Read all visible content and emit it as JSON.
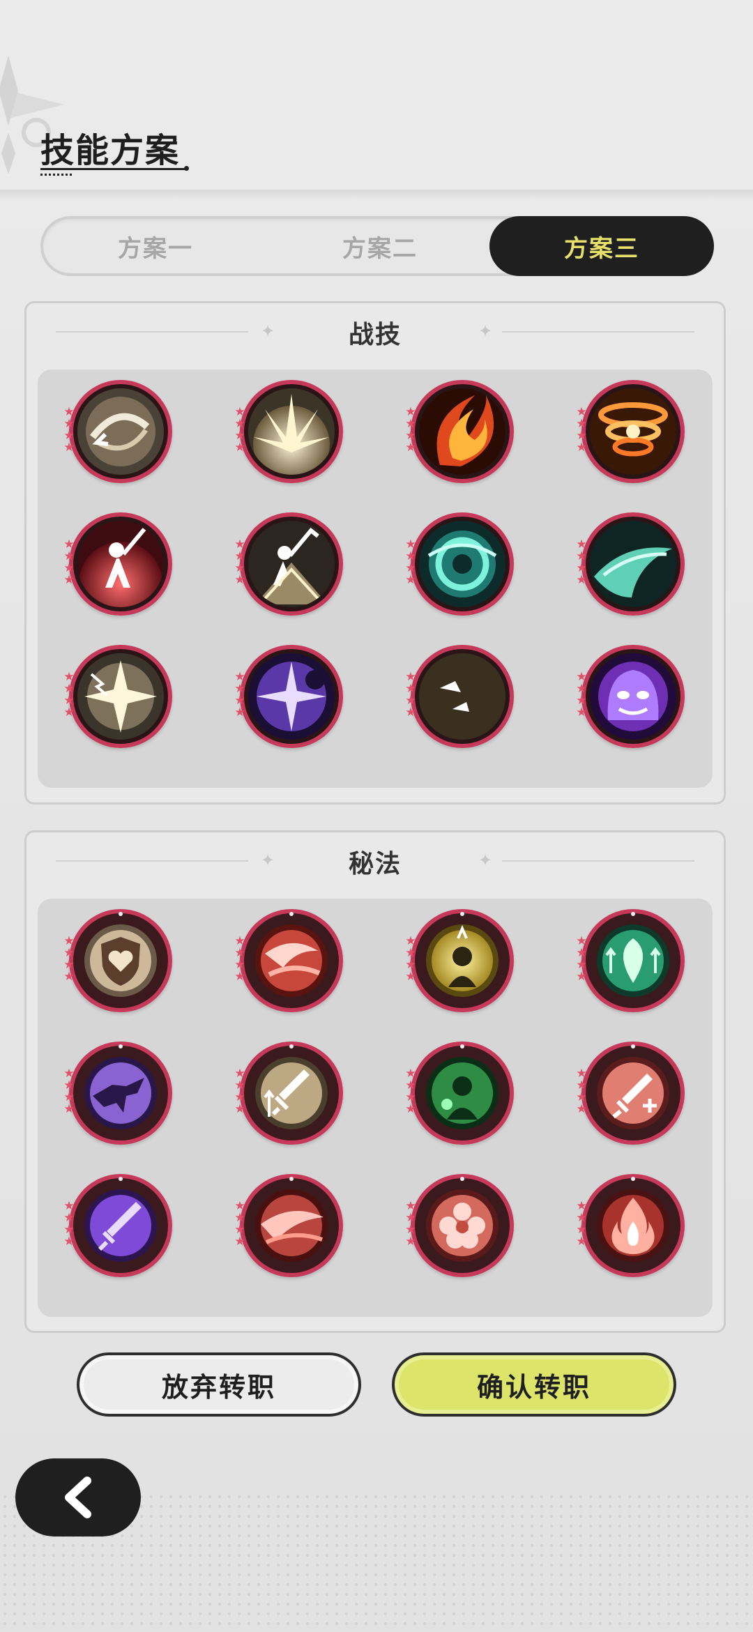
{
  "header": {
    "title": "技能方案"
  },
  "tabs": [
    {
      "label": "方案一",
      "active": false
    },
    {
      "label": "方案二",
      "active": false
    },
    {
      "label": "方案三",
      "active": true
    }
  ],
  "colors": {
    "accent_yellow": "#dce56a",
    "tab_active_bg": "#1f1f1f",
    "tab_active_text": "#e7e06a",
    "skill_border": "#c7395a"
  },
  "combat_skills": {
    "title": "战技",
    "items": [
      {
        "icon": "whirlwind-slash-icon",
        "stars": 4
      },
      {
        "icon": "ground-burst-icon",
        "stars": 4
      },
      {
        "icon": "fire-slash-icon",
        "stars": 4
      },
      {
        "icon": "fire-vortex-icon",
        "stars": 4
      },
      {
        "icon": "sword-raise-icon",
        "stars": 4
      },
      {
        "icon": "sword-strike-icon",
        "stars": 4
      },
      {
        "icon": "cyan-vortex-icon",
        "stars": 4
      },
      {
        "icon": "wind-slash-icon",
        "stars": 4
      },
      {
        "icon": "lightning-star-icon",
        "stars": 4
      },
      {
        "icon": "shadow-star-icon",
        "stars": 4
      },
      {
        "icon": "golden-crescent-icon",
        "stars": 4
      },
      {
        "icon": "ghost-spirit-icon",
        "stars": 4
      }
    ]
  },
  "arcane_skills": {
    "title": "秘法",
    "items": [
      {
        "icon": "heart-shield-icon",
        "stars": 4
      },
      {
        "icon": "red-slash-orb-icon",
        "stars": 4
      },
      {
        "icon": "golden-figure-icon",
        "stars": 4
      },
      {
        "icon": "leaf-arrows-icon",
        "stars": 4
      },
      {
        "icon": "raven-icon",
        "stars": 4
      },
      {
        "icon": "sword-up-arrows-icon",
        "stars": 4
      },
      {
        "icon": "green-figure-icon",
        "stars": 4
      },
      {
        "icon": "sword-cross-icon",
        "stars": 4
      },
      {
        "icon": "purple-sword-icon",
        "stars": 4
      },
      {
        "icon": "crimson-slash-icon",
        "stars": 4
      },
      {
        "icon": "flower-burst-icon",
        "stars": 4
      },
      {
        "icon": "flame-icon",
        "stars": 4
      }
    ]
  },
  "actions": {
    "cancel_label": "放弃转职",
    "confirm_label": "确认转职"
  },
  "nav": {
    "back_icon": "chevron-left-icon"
  }
}
